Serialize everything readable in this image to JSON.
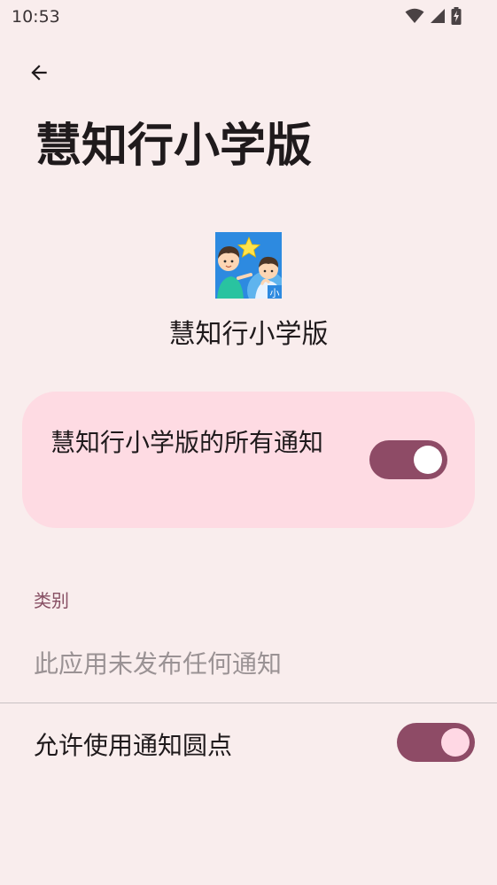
{
  "status_bar": {
    "time": "10:53",
    "icons": [
      "wifi-icon",
      "cell-signal-icon",
      "battery-charging-icon"
    ]
  },
  "header": {
    "back_icon": "arrow-back-icon",
    "title": "慧知行小学版"
  },
  "app": {
    "name": "慧知行小学版",
    "icon": "app-icon-children-star",
    "icon_badge": "小"
  },
  "master_switch": {
    "label": "慧知行小学版的所有通知",
    "on": true
  },
  "categories": {
    "label": "类别",
    "empty_text": "此应用未发布任何通知"
  },
  "notification_dot": {
    "label": "允许使用通知圆点",
    "on": true
  },
  "colors": {
    "background": "#f9eded",
    "card": "#fedbe3",
    "accent": "#8e4b66",
    "section_label": "#874f63"
  }
}
